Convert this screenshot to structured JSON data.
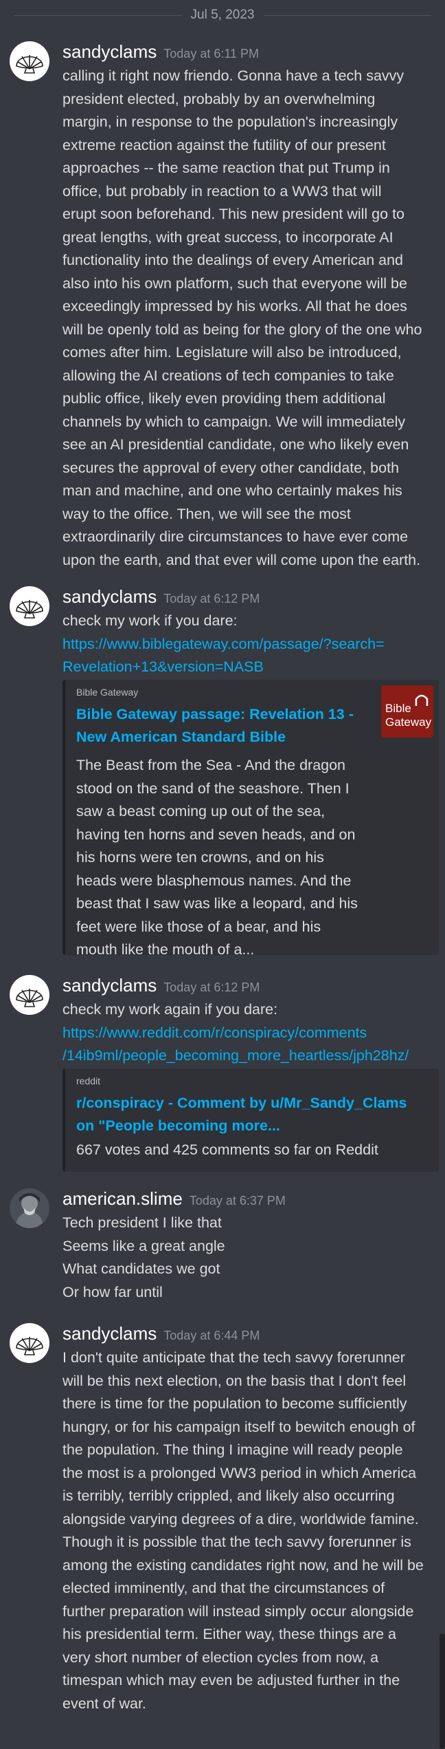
{
  "date_divider": "Jul 5, 2023",
  "messages": [
    {
      "author": "sandyclams",
      "time": "Today at 6:11 PM",
      "lines": [
        "calling it right now friendo. Gonna have a tech savvy",
        "president elected, probably by an overwhelming",
        "margin, in response to the population's increasingly",
        "extreme reaction against the futility of our present",
        "approaches -- the same reaction that put Trump in",
        "office, but probably in reaction to a WW3 that will",
        "erupt soon beforehand. This new president will go to",
        "great lengths, with great success, to incorporate AI",
        "functionality into the dealings of every American and",
        "also into his own platform, such that everyone will be",
        "exceedingly impressed by his works. All that he does",
        "will be openly told as being for the glory of the one who",
        "comes after him. Legislature will also be introduced,",
        "allowing the AI creations of tech companies to take",
        "public office, likely even providing them additional",
        "channels by which to campaign. We will immediately",
        "see an AI presidential candidate, one who likely even",
        "secures the approval of every other candidate, both",
        "man and machine, and one who certainly makes his",
        "way to the office. Then, we will see the most",
        "extraordinarily dire circumstances to have ever come",
        "upon the earth, and that ever will come upon the earth."
      ]
    },
    {
      "author": "sandyclams",
      "time": "Today at 6:12 PM",
      "text": "check my work if you dare:",
      "link_lines": [
        "https://www.biblegateway.com/passage/?search=",
        "Revelation+13&version=NASB"
      ],
      "embed": {
        "provider": "Bible Gateway",
        "title_lines": [
          "Bible Gateway passage: Revelation 13 -",
          "New American Standard Bible"
        ],
        "desc_lines": [
          "The Beast from the Sea - And the dragon",
          "stood on the sand of the seashore. Then I",
          "saw a beast coming up out of the sea,",
          "having ten horns and seven heads, and on",
          "his horns were ten crowns, and on his",
          "heads were blasphemous names. And the",
          "beast that I saw was like a leopard, and his",
          "feet were like those of a bear, and his",
          "mouth like the mouth of a..."
        ],
        "thumb_l1": "Bible",
        "thumb_l2": "Gateway"
      }
    },
    {
      "author": "sandyclams",
      "time": "Today at 6:12 PM",
      "text": "check my work again if you dare:",
      "link_lines": [
        "https://www.reddit.com/r/conspiracy/comments",
        "/14ib9ml/people_becoming_more_heartless/jph28hz/"
      ],
      "embed": {
        "provider": "reddit",
        "title_lines": [
          "r/conspiracy - Comment by u/Mr_Sandy_Clams",
          "on \"People becoming more..."
        ],
        "desc_lines": [
          "667 votes and 425 comments so far on Reddit"
        ]
      }
    },
    {
      "author": "american.slime",
      "time": "Today at 6:37 PM",
      "lines": [
        "Tech president I like that",
        "Seems like a great angle",
        "What candidates we got",
        "Or how far until"
      ]
    },
    {
      "author": "sandyclams",
      "time": "Today at 6:44 PM",
      "lines": [
        "I don't quite anticipate that the tech savvy forerunner",
        "will be this next election, on the basis that I don't feel",
        "there is time for the population to become sufficiently",
        "hungry, or for his campaign itself to bewitch enough of",
        "the population. The thing I imagine will ready people",
        "the most is a prolonged WW3 period in which America",
        "is terribly, terribly crippled, and likely also occurring",
        "alongside varying degrees of a dire, worldwide famine.",
        "Though it is possible that the tech savvy forerunner is",
        "among the existing candidates right now, and he will be",
        "elected imminently, and that the circumstances of",
        "further preparation will instead simply occur alongside",
        "his presidential term. Either way, these things are a",
        "very short number of election cycles from now, a",
        "timespan which may even be adjusted further in the",
        "event of war."
      ]
    }
  ],
  "colors": {
    "background": "#36393f",
    "embed_bg": "#2f3136",
    "link": "#00aff4",
    "username": "#ffffff",
    "timestamp": "#8e9297"
  },
  "icons": {
    "shell_avatar": "scallop-shell-icon",
    "slime_avatar": "user-photo-avatar"
  }
}
